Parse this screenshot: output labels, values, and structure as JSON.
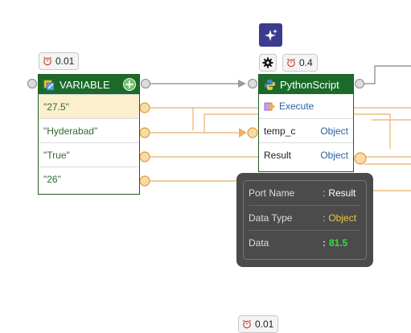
{
  "timers": {
    "variable": "0.01",
    "python": "0.4",
    "bottom": "0.01"
  },
  "variable_node": {
    "title": "VARIABLE",
    "rows": [
      "\"27.5\"",
      "\"Hyderabad\"",
      "\"True\"",
      "\"26\""
    ]
  },
  "python_node": {
    "title": "PythonScript",
    "execute_label": "Execute",
    "ports": [
      {
        "name": "temp_c",
        "type": "Object"
      },
      {
        "name": "Result",
        "type": "Object"
      }
    ]
  },
  "tooltip": {
    "port_name_label": "Port Name",
    "port_name_value": "Result",
    "data_type_label": "Data Type",
    "data_type_value": "Object",
    "data_label": "Data",
    "data_value": "81.5",
    "separator": ":"
  },
  "colors": {
    "node_header": "#1c6a2a",
    "wire_orange": "#e8b06a",
    "wire_gray": "#9a9a9a",
    "tooltip_bg": "#4b4b4b"
  }
}
